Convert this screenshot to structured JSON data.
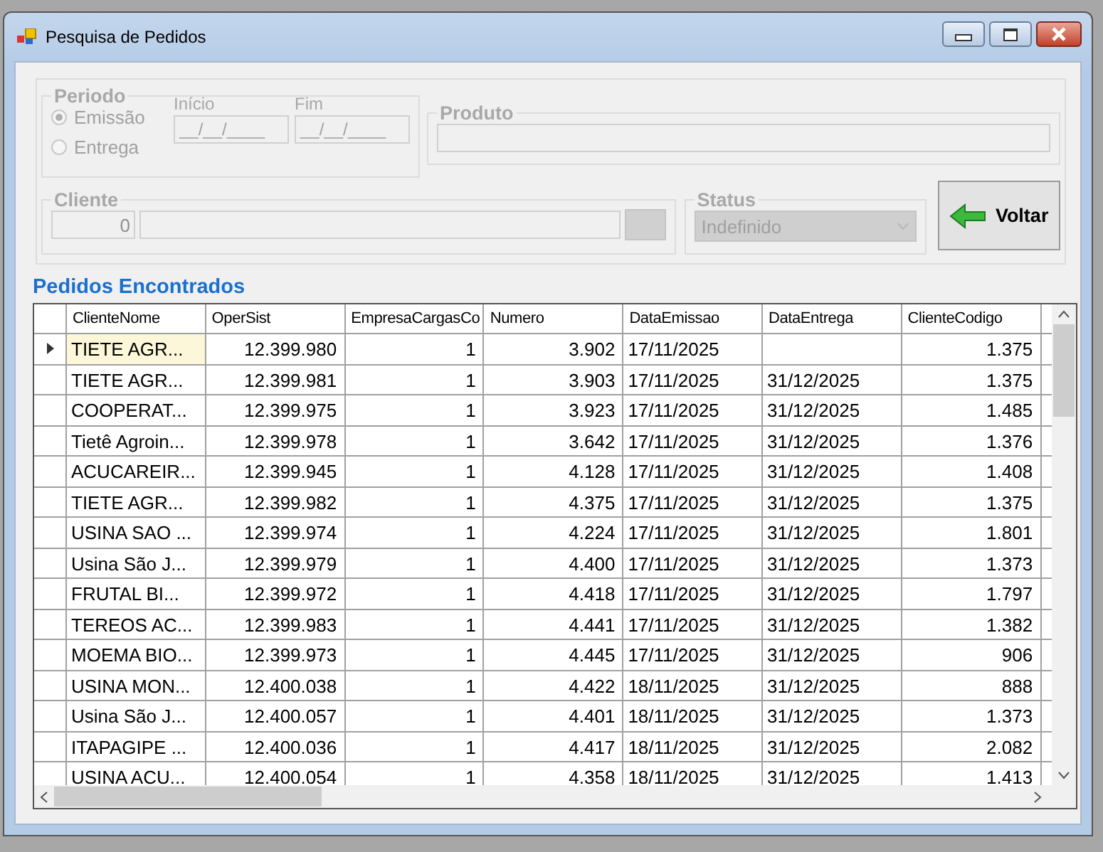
{
  "window": {
    "title": "Pesquisa de Pedidos"
  },
  "filters": {
    "disabled": true,
    "periodo": {
      "title": "Periodo",
      "options": [
        {
          "label": "Emissão",
          "selected": true
        },
        {
          "label": "Entrega",
          "selected": false
        }
      ],
      "inicio": {
        "label": "Início",
        "value": "__/__/____"
      },
      "fim": {
        "label": "Fim",
        "value": "__/__/____"
      }
    },
    "produto": {
      "title": "Produto"
    },
    "cliente": {
      "title": "Cliente",
      "code": "0"
    },
    "status": {
      "title": "Status",
      "value": "Indefinido"
    },
    "back_button": {
      "label": "Voltar"
    }
  },
  "results": {
    "title": "Pedidos Encontrados",
    "columns": [
      "ClienteNome",
      "OperSist",
      "EmpresaCargasCo",
      "Numero",
      "DataEmissao",
      "DataEntrega",
      "ClienteCodigo"
    ],
    "rows": [
      {
        "selected": true,
        "cells": [
          "TIETE AGR...",
          "12.399.980",
          "1",
          "3.902",
          "17/11/2025",
          "",
          "1.375"
        ]
      },
      {
        "selected": false,
        "cells": [
          "TIETE AGR...",
          "12.399.981",
          "1",
          "3.903",
          "17/11/2025",
          "31/12/2025",
          "1.375"
        ]
      },
      {
        "selected": false,
        "cells": [
          "COOPERAT...",
          "12.399.975",
          "1",
          "3.923",
          "17/11/2025",
          "31/12/2025",
          "1.485"
        ]
      },
      {
        "selected": false,
        "cells": [
          "Tietê Agroin...",
          "12.399.978",
          "1",
          "3.642",
          "17/11/2025",
          "31/12/2025",
          "1.376"
        ]
      },
      {
        "selected": false,
        "cells": [
          "ACUCAREIR...",
          "12.399.945",
          "1",
          "4.128",
          "17/11/2025",
          "31/12/2025",
          "1.408"
        ]
      },
      {
        "selected": false,
        "cells": [
          "TIETE AGR...",
          "12.399.982",
          "1",
          "4.375",
          "17/11/2025",
          "31/12/2025",
          "1.375"
        ]
      },
      {
        "selected": false,
        "cells": [
          "USINA SAO ...",
          "12.399.974",
          "1",
          "4.224",
          "17/11/2025",
          "31/12/2025",
          "1.801"
        ]
      },
      {
        "selected": false,
        "cells": [
          "Usina São J...",
          "12.399.979",
          "1",
          "4.400",
          "17/11/2025",
          "31/12/2025",
          "1.373"
        ]
      },
      {
        "selected": false,
        "cells": [
          "FRUTAL BI...",
          "12.399.972",
          "1",
          "4.418",
          "17/11/2025",
          "31/12/2025",
          "1.797"
        ]
      },
      {
        "selected": false,
        "cells": [
          "TEREOS AC...",
          "12.399.983",
          "1",
          "4.441",
          "17/11/2025",
          "31/12/2025",
          "1.382"
        ]
      },
      {
        "selected": false,
        "cells": [
          "MOEMA BIO...",
          "12.399.973",
          "1",
          "4.445",
          "17/11/2025",
          "31/12/2025",
          "906"
        ]
      },
      {
        "selected": false,
        "cells": [
          "USINA MON...",
          "12.400.038",
          "1",
          "4.422",
          "18/11/2025",
          "31/12/2025",
          "888"
        ]
      },
      {
        "selected": false,
        "cells": [
          "Usina São J...",
          "12.400.057",
          "1",
          "4.401",
          "18/11/2025",
          "31/12/2025",
          "1.373"
        ]
      },
      {
        "selected": false,
        "cells": [
          "ITAPAGIPE ...",
          "12.400.036",
          "1",
          "4.417",
          "18/11/2025",
          "31/12/2025",
          "2.082"
        ]
      },
      {
        "selected": false,
        "cells": [
          "USINA ACU...",
          "12.400.054",
          "1",
          "4.358",
          "18/11/2025",
          "31/12/2025",
          "1.413"
        ]
      }
    ]
  }
}
